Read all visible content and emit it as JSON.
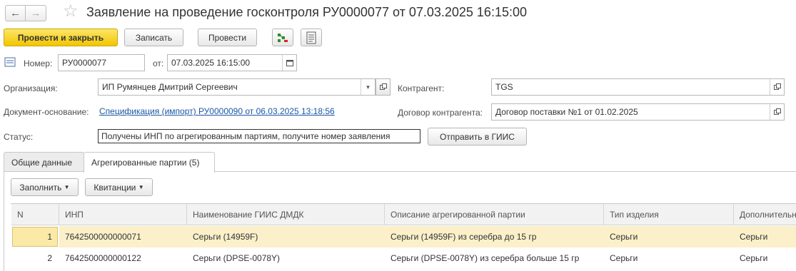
{
  "window": {
    "title": "Заявление на проведение госконтроля РУ0000077 от 07.03.2025 16:15:00"
  },
  "toolbar": {
    "post_close_label": "Провести и закрыть",
    "save_label": "Записать",
    "post_label": "Провести"
  },
  "header": {
    "number_label": "Номер:",
    "number_value": "РУ0000077",
    "date_label": "от:",
    "date_value": "07.03.2025 16:15:00"
  },
  "form": {
    "org_label": "Организация:",
    "org_value": "ИП Румянцев Дмитрий Сергеевич",
    "counterparty_label": "Контрагент:",
    "counterparty_value": "TGS",
    "base_doc_label": "Документ-основание:",
    "base_doc_value": "Спецификация (импорт) РУ0000090 от 06.03.2025 13:18:56",
    "contract_label": "Договор контрагента:",
    "contract_value": "Договор поставки №1 от 01.02.2025",
    "status_label": "Статус:",
    "status_value": "Получены ИНП по агрегированным партиям, получите номер заявления",
    "send_label": "Отправить в ГИИС"
  },
  "tabs": [
    {
      "label": "Общие данные"
    },
    {
      "label": "Агрегированные партии (5)"
    }
  ],
  "panel": {
    "fill_label": "Заполнить",
    "receipts_label": "Квитанции"
  },
  "table": {
    "columns": [
      "N",
      "ИНП",
      "Наименование ГИИС ДМДК",
      "Описание агрегированной партии",
      "Тип изделия",
      "Дополнительные"
    ],
    "rows": [
      [
        "1",
        "7642500000000071",
        "Серьги (14959F)",
        "Серьги (14959F) из серебра до 15 гр",
        "Серьги",
        "Серьги"
      ],
      [
        "2",
        "7642500000000122",
        "Серьги (DPSE-0078Y)",
        "Серьги (DPSE-0078Y) из серебра больше 15 гр",
        "Серьги",
        "Серьги"
      ]
    ]
  },
  "colors": {
    "primary_button": "#f2c500",
    "link": "#1a57a5",
    "selected_row": "#fbf0c9"
  }
}
